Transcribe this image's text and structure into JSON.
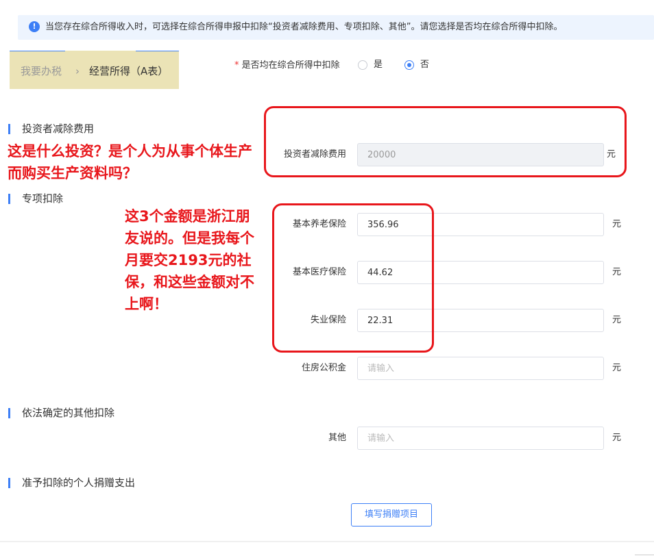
{
  "notice": {
    "icon": "info-icon",
    "icon_glyph": "!",
    "text": "当您存在综合所得收入时，可选择在综合所得申报中扣除“投资者减除费用、专项扣除、其他”。请您选择是否均在综合所得中扣除。"
  },
  "breadcrumb": {
    "home": "我要办税",
    "separator": "›",
    "current": "经营所得（A表）"
  },
  "question": {
    "required_mark": "*",
    "label": "是否均在综合所得中扣除",
    "options": [
      {
        "label": "是",
        "selected": false
      },
      {
        "label": "否",
        "selected": true
      }
    ]
  },
  "sections": {
    "investor": {
      "title": "投资者减除费用"
    },
    "special": {
      "title": "专项扣除"
    },
    "other": {
      "title": "依法确定的其他扣除"
    },
    "donation": {
      "title": "准予扣除的个人捐赠支出",
      "button_label": "填写捐赠项目"
    }
  },
  "fields": {
    "investor_deduction": {
      "label": "投资者减除费用",
      "value": "20000",
      "disabled": true,
      "unit": "元"
    },
    "pension": {
      "label": "基本养老保险",
      "value": "356.96",
      "unit": "元"
    },
    "medical": {
      "label": "基本医疗保险",
      "value": "44.62",
      "unit": "元"
    },
    "unemployment": {
      "label": "失业保险",
      "value": "22.31",
      "unit": "元"
    },
    "housing_fund": {
      "label": "住房公积金",
      "value": "",
      "placeholder": "请输入",
      "unit": "元"
    },
    "other": {
      "label": "其他",
      "value": "",
      "placeholder": "请输入",
      "unit": "元"
    }
  },
  "annotations": {
    "note1": "这是什么投资？是个人为从事个体生产而购买生产资料吗？",
    "note2": "这3个金额是浙江朋友说的。但是我每个月要交2193元的社保，和这些金额对不上啊！"
  },
  "colors": {
    "accent": "#3d7ff6",
    "annotation_red": "#e8161b",
    "notice_bg": "#edf4fe",
    "breadcrumb_highlight": "#ebe3b6"
  }
}
